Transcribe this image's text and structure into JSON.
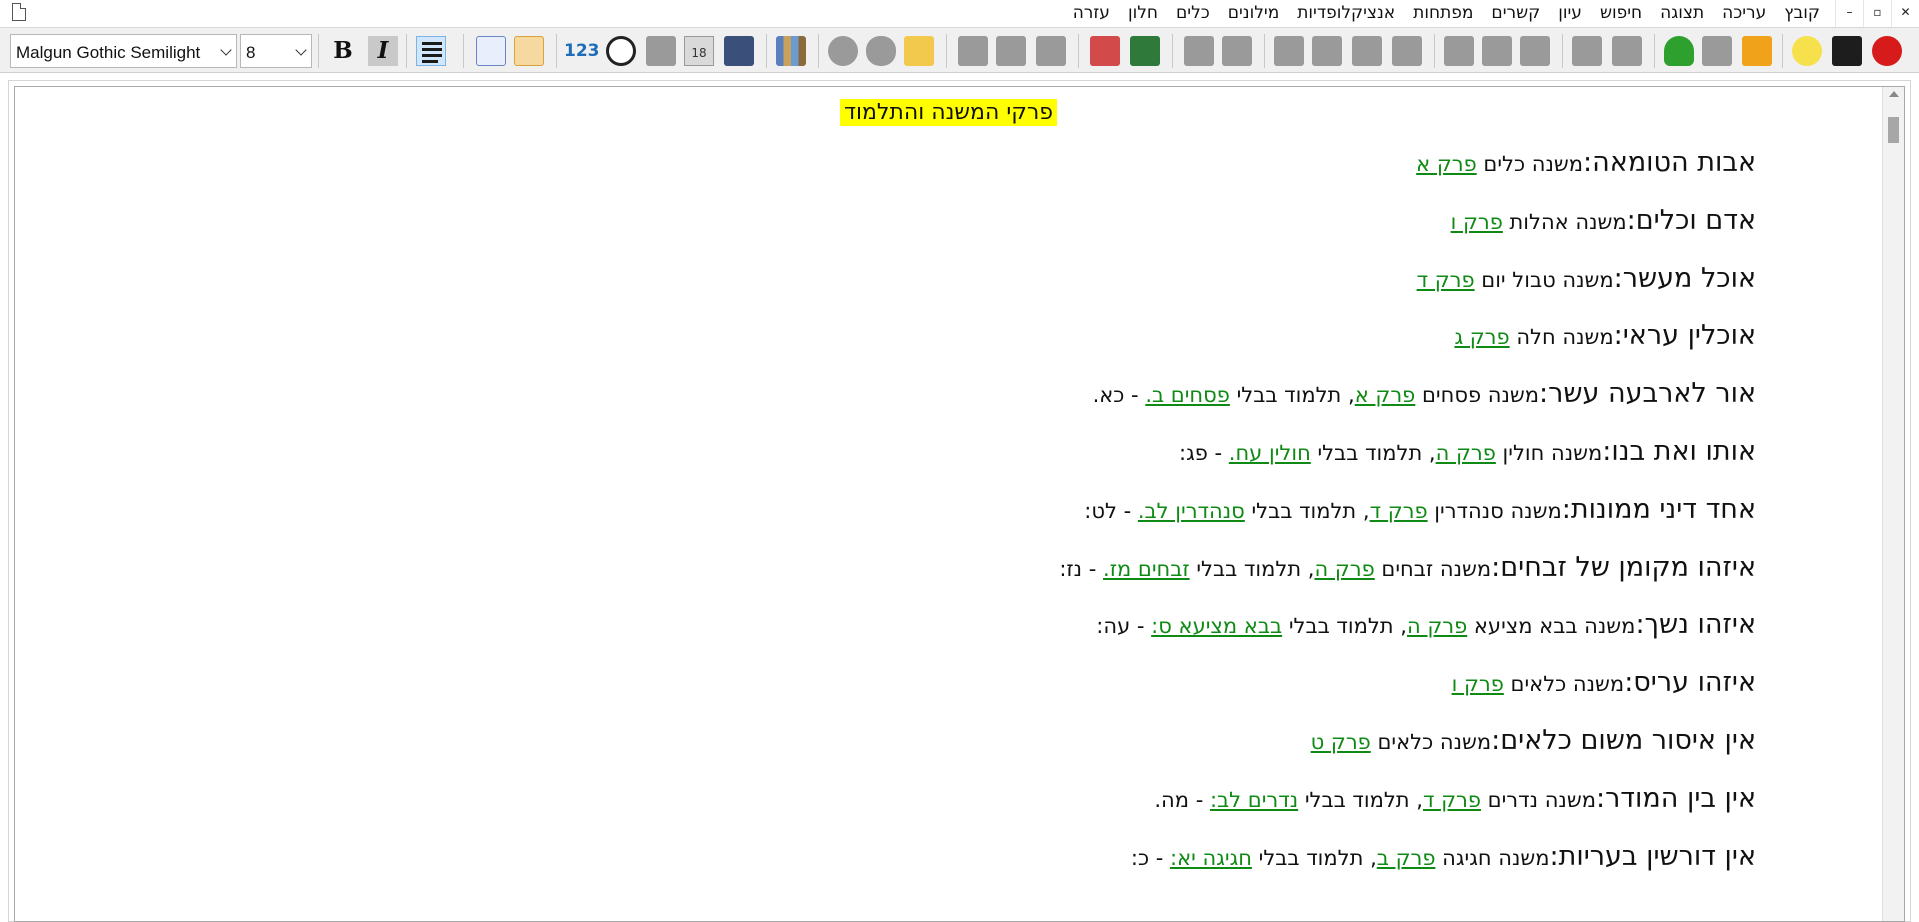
{
  "menu": [
    "קובץ",
    "עריכה",
    "תצוגה",
    "חיפוש",
    "עיון",
    "קשרים",
    "מפתחות",
    "אנציקלופדיות",
    "מילונים",
    "כלים",
    "חלון",
    "עזרה"
  ],
  "window_controls": {
    "minimize": "–",
    "restore": "▫",
    "close": "✕"
  },
  "toolbar": {
    "font_name": "Malgun Gothic Semilight",
    "font_size": "8",
    "bold_label": "B",
    "italic_label": "I",
    "numbers_label": "123",
    "calendar_label": "18"
  },
  "icons": [
    "document-icon",
    "bold-icon",
    "italic-icon",
    "align-icon",
    "grid-icon",
    "table-icon",
    "numbers-icon",
    "person-icon",
    "upload-icon",
    "calendar-icon",
    "notebook-icon",
    "books-icon",
    "help-icon",
    "cloud-icon",
    "folder-icon",
    "flask-icon",
    "beaker-icon",
    "bridge-icon",
    "magnifier-icon",
    "book-icon",
    "page-icon",
    "search-page-icon",
    "tree-structure-icon",
    "move-icon",
    "text-page-icon",
    "eraser-icon",
    "arrow-right-icon",
    "arrow-left-icon",
    "list-icon",
    "indent-icon",
    "outdent-icon",
    "tree-icon",
    "undo-icon",
    "lock-icon",
    "lightbulb-icon",
    "translate-icon",
    "pomegranate-icon"
  ],
  "colors": {
    "link": "#0f8a14",
    "highlight": "#ffff00",
    "toolbar_bg": "#f0f0f0"
  },
  "document": {
    "title": "פרקי המשנה והתלמוד",
    "entries": [
      {
        "term": "אבות הטומאה:",
        "mishna": " משנה כלים ",
        "perek": "פרק א",
        "rest": []
      },
      {
        "term": "אדם וכלים:",
        "mishna": " משנה אהלות ",
        "perek": "פרק ו",
        "rest": []
      },
      {
        "term": "אוכל מעשר:",
        "mishna": " משנה טבול יום ",
        "perek": "פרק ד",
        "rest": []
      },
      {
        "term": "אוכלין עראי:",
        "mishna": " משנה חלה ",
        "perek": "פרק ג",
        "rest": []
      },
      {
        "term": "אור לארבעה עשר:",
        "mishna": " משנה פסחים ",
        "perek": "פרק א",
        "talmud": ", תלמוד בבלי ",
        "daf": "פסחים ב.",
        "until": " - כא."
      },
      {
        "term": "אותו ואת בנו:",
        "mishna": " משנה חולין ",
        "perek": "פרק ה",
        "talmud": ", תלמוד בבלי ",
        "daf": "חולין עח.",
        "until": " - פג:"
      },
      {
        "term": "אחד דיני ממונות:",
        "mishna": " משנה סנהדרין ",
        "perek": "פרק ד",
        "talmud": ", תלמוד בבלי ",
        "daf": "סנהדרין לב.",
        "until": " - לט:"
      },
      {
        "term": "איזהו מקומן של זבחים:",
        "mishna": " משנה זבחים ",
        "perek": "פרק ה",
        "talmud": ", תלמוד בבלי ",
        "daf": "זבחים מז.",
        "until": " - נז:"
      },
      {
        "term": "איזהו נשך:",
        "mishna": " משנה בבא מציעא ",
        "perek": "פרק ה",
        "talmud": ", תלמוד בבלי ",
        "daf": "בבא מציעא ס:",
        "until": " - עה:"
      },
      {
        "term": "איזהו עריס:",
        "mishna": " משנה כלאים ",
        "perek": "פרק ו",
        "rest": []
      },
      {
        "term": "אין איסור משום כלאים:",
        "mishna": " משנה כלאים ",
        "perek": "פרק ט",
        "rest": []
      },
      {
        "term": "אין בין המודר:",
        "mishna": " משנה נדרים ",
        "perek": "פרק ד",
        "talmud": ", תלמוד בבלי ",
        "daf": "נדרים לב:",
        "until": " - מה."
      },
      {
        "term": "אין דורשין בעריות:",
        "mishna": " משנה חגיגה ",
        "perek": "פרק ב",
        "talmud": ", תלמוד בבלי ",
        "daf": "חגיגה יא:",
        "until": " - כ:"
      }
    ]
  }
}
